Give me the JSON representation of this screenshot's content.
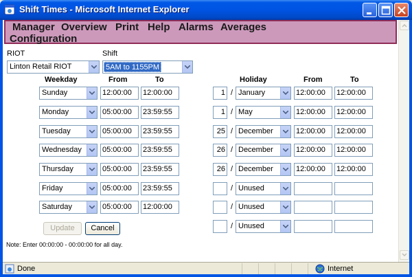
{
  "window": {
    "title": "Shift Times - Microsoft Internet Explorer",
    "icon": "ie-icon",
    "controls": [
      "minimize-icon",
      "maximize-icon",
      "close-icon"
    ]
  },
  "menu": {
    "items": [
      "Manager",
      "Overview",
      "Print",
      "Help",
      "Alarms",
      "Averages",
      "Configuration"
    ],
    "background": "#cc99bb",
    "border": "#8f2d57"
  },
  "form": {
    "riot_label": "RIOT",
    "riot_value": "Linton Retail RIOT",
    "shift_label": "Shift",
    "shift_value": "5AM to 1155PM"
  },
  "weekday_table": {
    "headers": {
      "weekday": "Weekday",
      "from": "From",
      "to": "To"
    },
    "rows": [
      {
        "day": "Sunday",
        "from": "12:00:00",
        "to": "12:00:00"
      },
      {
        "day": "Monday",
        "from": "05:00:00",
        "to": "23:59:55"
      },
      {
        "day": "Tuesday",
        "from": "05:00:00",
        "to": "23:59:55"
      },
      {
        "day": "Wednesday",
        "from": "05:00:00",
        "to": "23:59:55"
      },
      {
        "day": "Thursday",
        "from": "05:00:00",
        "to": "23:59:55"
      },
      {
        "day": "Friday",
        "from": "05:00:00",
        "to": "23:59:55"
      },
      {
        "day": "Saturday",
        "from": "05:00:00",
        "to": "12:00:00"
      }
    ]
  },
  "holiday_table": {
    "headers": {
      "holiday": "Holiday",
      "from": "From",
      "to": "To"
    },
    "separator": "/",
    "rows": [
      {
        "day": "1",
        "month": "January",
        "from": "12:00:00",
        "to": "12:00:00"
      },
      {
        "day": "1",
        "month": "May",
        "from": "12:00:00",
        "to": "12:00:00"
      },
      {
        "day": "25",
        "month": "December",
        "from": "12:00:00",
        "to": "12:00:00"
      },
      {
        "day": "26",
        "month": "December",
        "from": "12:00:00",
        "to": "12:00:00"
      },
      {
        "day": "26",
        "month": "December",
        "from": "12:00:00",
        "to": "12:00:00"
      },
      {
        "day": "",
        "month": "Unused",
        "from": "",
        "to": ""
      },
      {
        "day": "",
        "month": "Unused",
        "from": "",
        "to": ""
      },
      {
        "day": "",
        "month": "Unused",
        "from": "",
        "to": ""
      }
    ]
  },
  "buttons": {
    "update": "Update",
    "cancel": "Cancel"
  },
  "note": "Note: Enter 00:00:00 - 00:00:00 for all day.",
  "status": {
    "left": "Done",
    "zone": "Internet"
  }
}
